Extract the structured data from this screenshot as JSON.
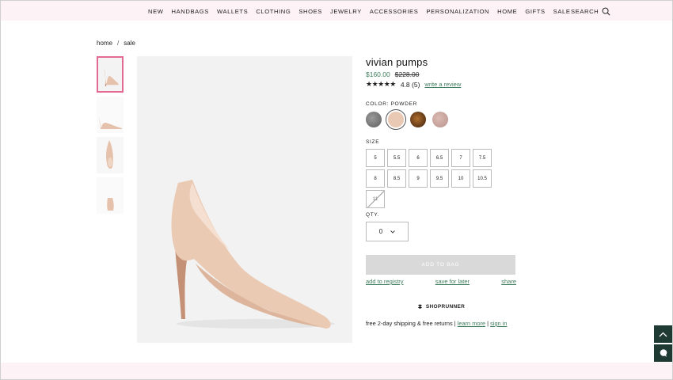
{
  "nav": {
    "items": [
      "NEW",
      "HANDBAGS",
      "WALLETS",
      "CLOTHING",
      "SHOES",
      "JEWELRY",
      "ACCESSORIES",
      "PERSONALIZATION",
      "HOME",
      "GIFTS",
      "SALE"
    ],
    "search_label": "SEARCH"
  },
  "breadcrumb": {
    "items": [
      "home",
      "sale"
    ],
    "separator": "/"
  },
  "product": {
    "title": "vivian pumps",
    "sale_price": "$160.00",
    "original_price": "$228.00",
    "stars": "★★★★★",
    "rating": "4.8 (5)",
    "review_link": "write a review",
    "color_label": "COLOR: POWDER",
    "swatches": [
      {
        "name": "glitter",
        "color": "#7b7b7b"
      },
      {
        "name": "powder",
        "color": "#e9c8b4",
        "selected": true
      },
      {
        "name": "tortoise",
        "color": "#5c3418"
      },
      {
        "name": "rose glitter",
        "color": "#c9a39c"
      }
    ],
    "size_label": "SIZE",
    "sizes": [
      {
        "label": "5",
        "available": true
      },
      {
        "label": "5.5",
        "available": true
      },
      {
        "label": "6",
        "available": true
      },
      {
        "label": "6.5",
        "available": true
      },
      {
        "label": "7",
        "available": true
      },
      {
        "label": "7.5",
        "available": true
      },
      {
        "label": "8",
        "available": true
      },
      {
        "label": "8.5",
        "available": true
      },
      {
        "label": "9",
        "available": true
      },
      {
        "label": "9.5",
        "available": true
      },
      {
        "label": "10",
        "available": true
      },
      {
        "label": "10.5",
        "available": true
      },
      {
        "label": "11",
        "available": false
      }
    ],
    "qty_label": "QTY.",
    "qty_value": "0",
    "add_to_bag": "ADD TO BAG",
    "add_to_registry": "add to registry",
    "save_for_later": "save for later",
    "share": "share",
    "shoprunner": "SHOPRUNNER",
    "shipping_text": "free 2-day shipping & free returns",
    "learn_more": "learn more",
    "sign_in": "sign in",
    "divider": "|"
  },
  "colors": {
    "accent_green": "#3f7d5c",
    "pink_band": "#fdf2f5",
    "thumb_border": "#e46a93",
    "side_button": "#1f3a33"
  },
  "icons": {
    "search": "search-icon",
    "zoom": "zoom-plus-icon",
    "scroll_top": "chevron-up-icon",
    "chat": "chat-icon"
  }
}
